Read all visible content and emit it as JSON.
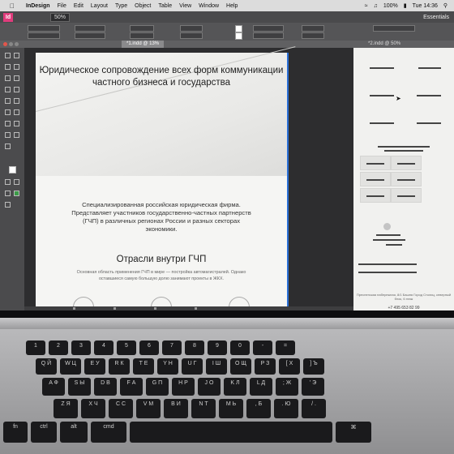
{
  "menubar": {
    "apple": "",
    "items": [
      "InDesign",
      "File",
      "Edit",
      "Layout",
      "Type",
      "Object",
      "Table",
      "View",
      "Window",
      "Help"
    ],
    "battery": "100%",
    "clock": "Tue 14:36"
  },
  "appbar": {
    "logo": "Id",
    "zoom": "50%",
    "workspace": "Essentials"
  },
  "tabs": {
    "doc1": "*2.indd @ 50%",
    "doc2": "*1.indd @ 13%"
  },
  "document": {
    "hero_title": "Юридическое сопровождение всех форм коммуникации частного бизнеса и государства",
    "description": "Специализированная российская юридическая фирма. Представляет участников государственно-частных партнерств (ГЧП) в различных регионах России и разных секторах экономики.",
    "section_title": "Отрасли внутри ГЧП",
    "section_text": "Основная область применения ГЧП в мире — постройка автомагистралей. Однако оставшиеся самую большую долю занимают проекты в ЖКХ."
  },
  "mockup": {
    "footer_text": "Пресненская набережная, 8/1 Башня Город Столиц, северный блок, 6 этаж",
    "phone": "+7 495 653 82 99"
  },
  "keyboard": {
    "row_numbers": [
      "1",
      "2",
      "3",
      "4",
      "5",
      "6",
      "7",
      "8",
      "9",
      "0",
      "-",
      "="
    ],
    "row_q": [
      "Q Й",
      "W Ц",
      "E У",
      "R К",
      "T Е",
      "Y Н",
      "U Г",
      "I Ш",
      "O Щ",
      "P З",
      "[ Х",
      "] Ъ"
    ],
    "row_a": [
      "A Ф",
      "S Ы",
      "D В",
      "F А",
      "G П",
      "H Р",
      "J О",
      "K Л",
      "L Д",
      "; Ж",
      "' Э"
    ],
    "row_z": [
      "Z Я",
      "X Ч",
      "C С",
      "V М",
      "B И",
      "N Т",
      "M Ь",
      ", Б",
      ". Ю",
      "/ ."
    ],
    "cmd_left": "cmd",
    "cmd_right": "⌘",
    "alt_left": "alt",
    "ctrl": "ctrl",
    "fn": "fn"
  },
  "colors": {
    "indesign_brand": "#e03c7c",
    "selection": "#2a6fd6"
  }
}
